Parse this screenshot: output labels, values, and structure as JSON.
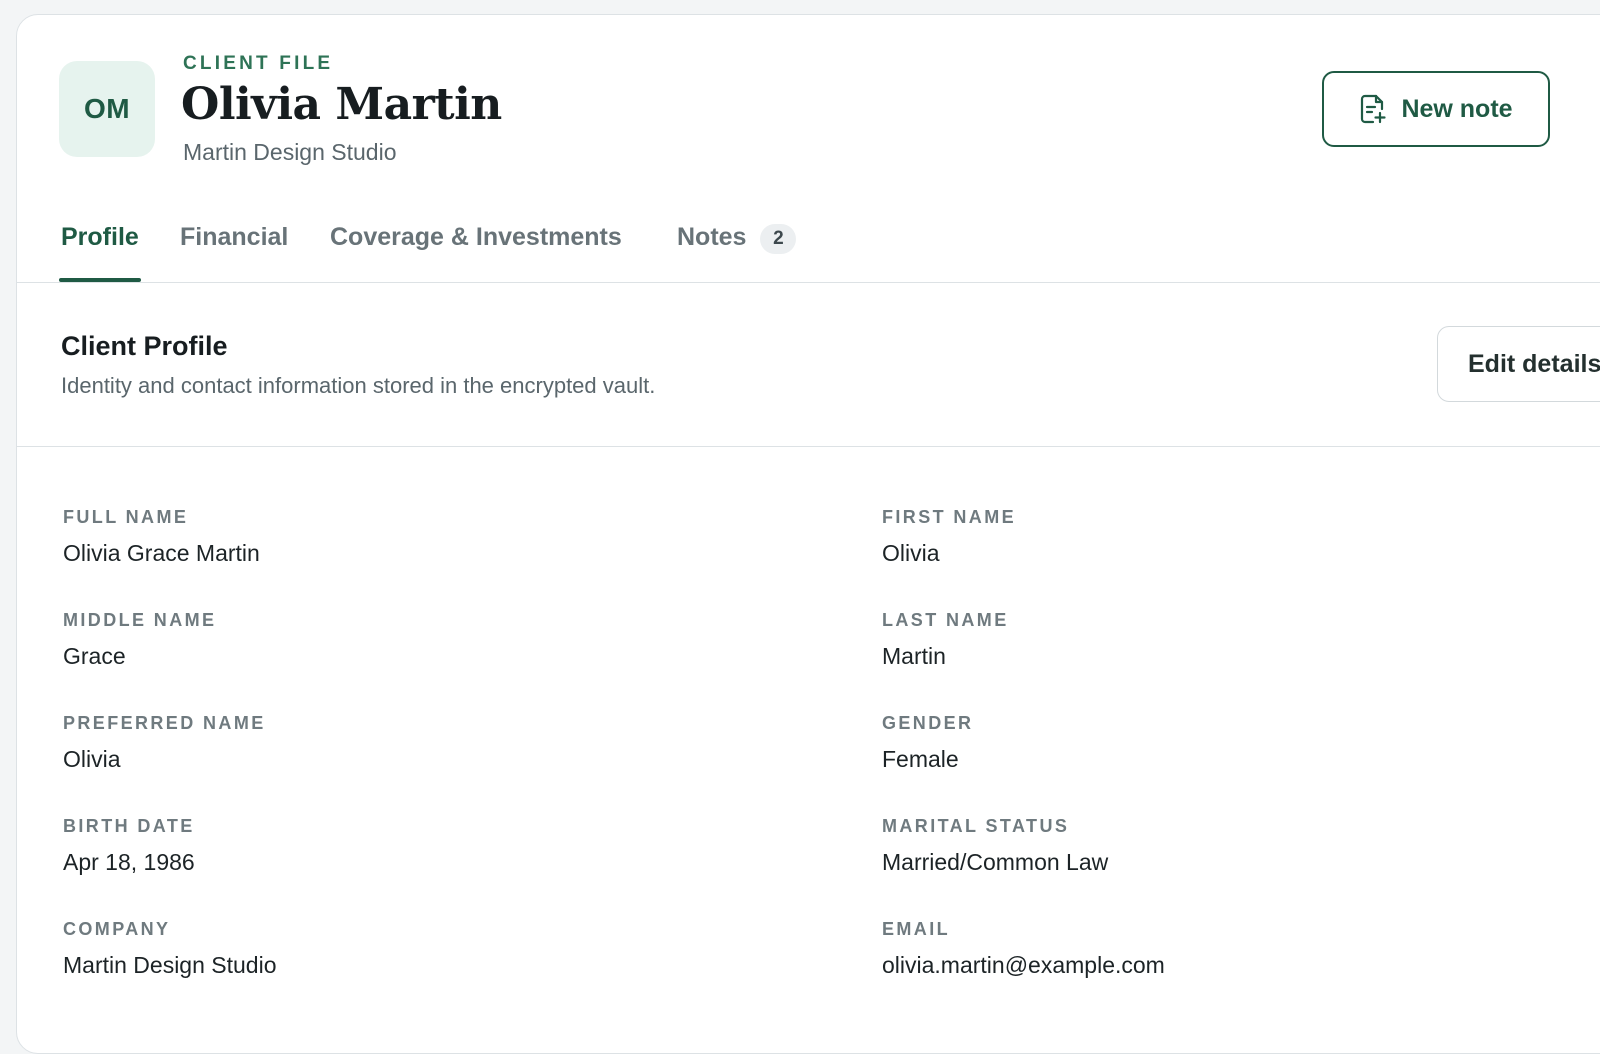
{
  "header": {
    "avatar_initials": "OM",
    "eyebrow": "CLIENT FILE",
    "client_name": "Olivia Martin",
    "client_company": "Martin Design Studio",
    "new_note_label": "New note"
  },
  "tabs": [
    {
      "label": "Profile",
      "active": true
    },
    {
      "label": "Financial"
    },
    {
      "label": "Coverage & Investments"
    },
    {
      "label": "Notes",
      "badge": "2"
    }
  ],
  "section": {
    "title": "Client Profile",
    "description": "Identity and contact information stored in the encrypted vault.",
    "edit_label": "Edit details"
  },
  "fields": {
    "full_name": {
      "label": "Full Name",
      "value": "Olivia Grace Martin"
    },
    "first_name": {
      "label": "First Name",
      "value": "Olivia"
    },
    "middle_name": {
      "label": "Middle Name",
      "value": "Grace"
    },
    "last_name": {
      "label": "Last Name",
      "value": "Martin"
    },
    "preferred_name": {
      "label": "Preferred Name",
      "value": "Olivia"
    },
    "gender": {
      "label": "Gender",
      "value": "Female"
    },
    "birth_date": {
      "label": "Birth Date",
      "value": "Apr 18, 1986"
    },
    "marital_status": {
      "label": "Marital Status",
      "value": "Married/Common Law"
    },
    "company": {
      "label": "Company",
      "value": "Martin Design Studio"
    },
    "email": {
      "label": "Email",
      "value": "olivia.martin@example.com"
    }
  },
  "colors": {
    "accent": "#1f5a44",
    "accent_light": "#e6f3ee",
    "eyebrow": "#2e7356"
  },
  "icons": {
    "new_note": "note-add-icon"
  }
}
